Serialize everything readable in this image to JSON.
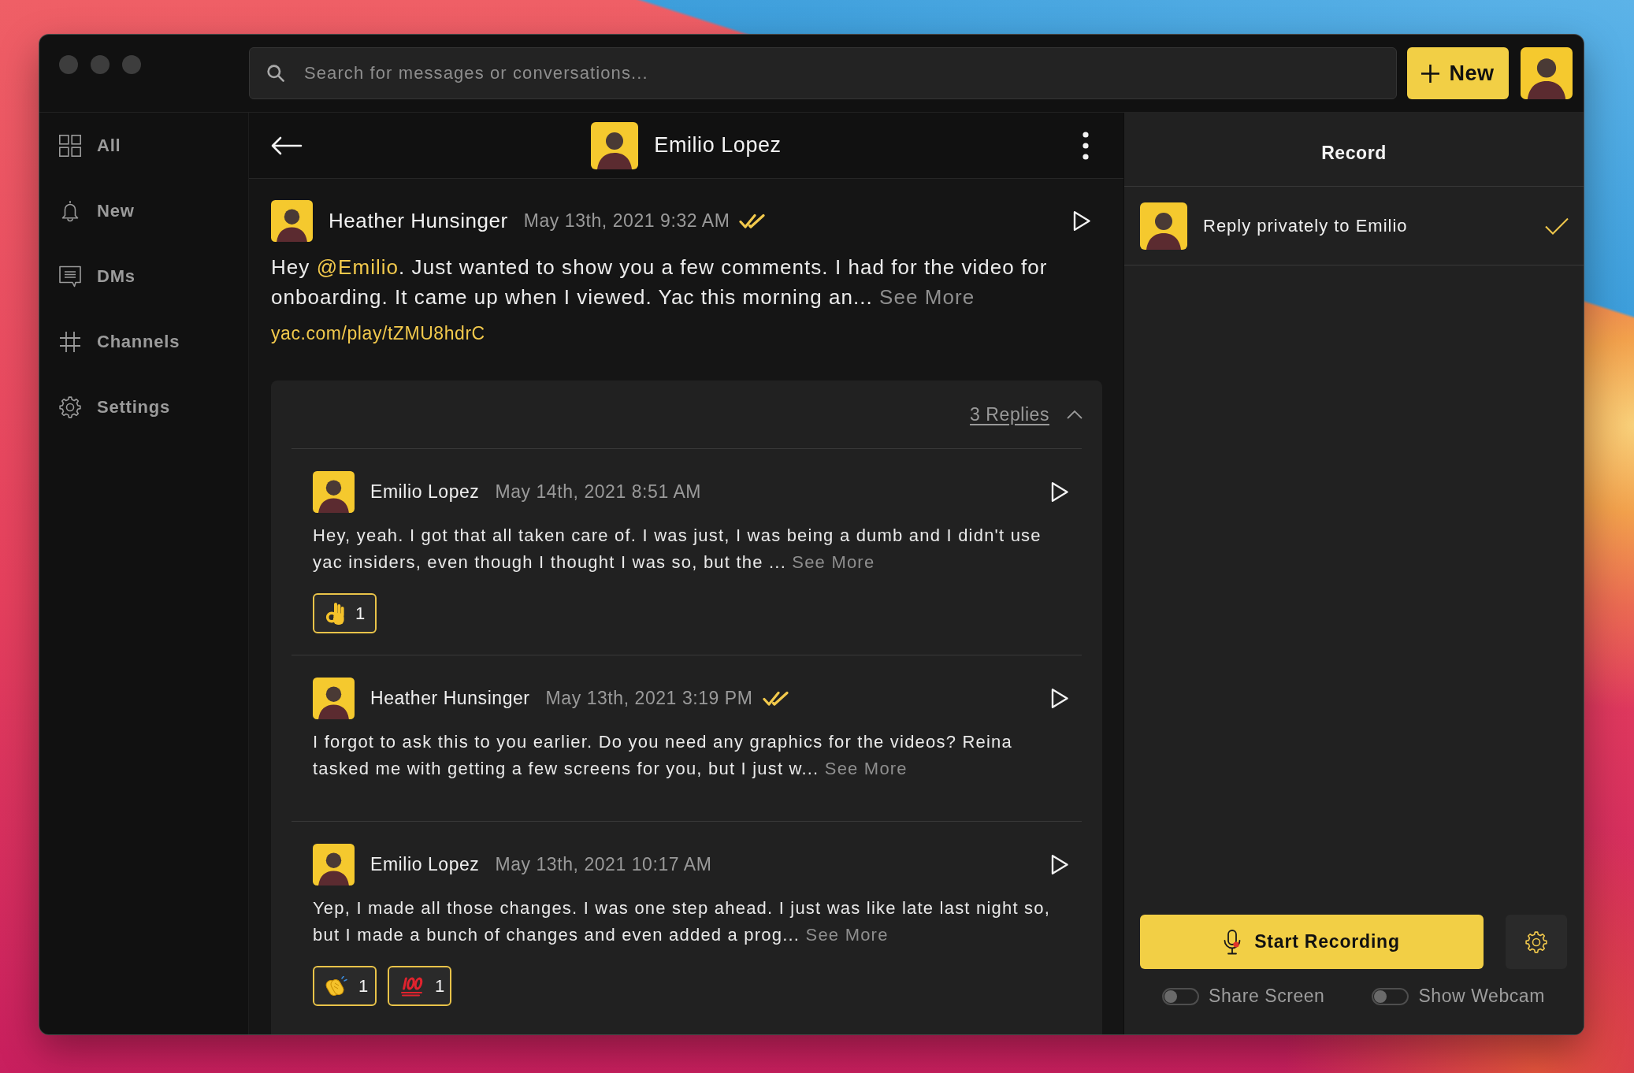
{
  "titlebar": {
    "search": {
      "placeholder": "Search for messages or conversations..."
    },
    "new_button": {
      "label": "New"
    }
  },
  "sidebar": {
    "items": [
      {
        "label": "All",
        "selected": false
      },
      {
        "label": "New",
        "selected": false
      },
      {
        "label": "DMs",
        "selected": false
      },
      {
        "label": "Channels",
        "selected": false
      },
      {
        "label": "Settings",
        "selected": false
      }
    ]
  },
  "conversation": {
    "title": "Emilio Lopez"
  },
  "message": {
    "author": "Heather Hunsinger",
    "time": "May 13th, 2021 9:32 AM",
    "seen": true,
    "text": [
      {
        "kind": "plain",
        "text": "Hey "
      },
      {
        "kind": "mention",
        "text": "@Emilio"
      },
      {
        "kind": "plain",
        "text": ". Just wanted to show you a few comments. I had for the video for onboarding. It came up when I viewed. Yac this morning an..."
      }
    ],
    "see_more": "See More",
    "link": "yac.com/play/tZMU8hdrC"
  },
  "replies": {
    "label": "3 Replies",
    "expanded": true,
    "items": [
      {
        "author": "Emilio Lopez",
        "time": "May 14th, 2021 8:51 AM",
        "seen": false,
        "text": "Hey, yeah. I got that all taken care of. I was just, I was being a dumb and I didn't use yac insiders, even though I thought I was so, but the ...",
        "see_more": "See More",
        "reactions": [
          {
            "kind": "ok_hand",
            "count": "1"
          }
        ]
      },
      {
        "author": "Heather Hunsinger",
        "time": "May 13th, 2021 3:19 PM",
        "seen": true,
        "text": "I forgot to ask this to you earlier. Do you need any graphics for the videos? Reina tasked me with getting a few screens for you, but I just w...",
        "see_more": "See More"
      },
      {
        "author": "Emilio Lopez",
        "time": "May 13th, 2021 10:17 AM",
        "seen": false,
        "text": "Yep, I made all those changes. I was one step ahead. I just was like late last night so, but I made a bunch of changes and even added a prog...",
        "see_more": "See More",
        "reactions": [
          {
            "kind": "clap",
            "count": "1"
          },
          {
            "kind": "hundred",
            "count": "1"
          }
        ]
      }
    ]
  },
  "record_panel": {
    "title": "Record",
    "recipient": {
      "label": "Reply privately to Emilio",
      "selected": true
    },
    "start_button": {
      "label": "Start Recording"
    },
    "toggles": [
      {
        "label": "Share Screen",
        "on": false
      },
      {
        "label": "Show Webcam",
        "on": false
      }
    ]
  }
}
